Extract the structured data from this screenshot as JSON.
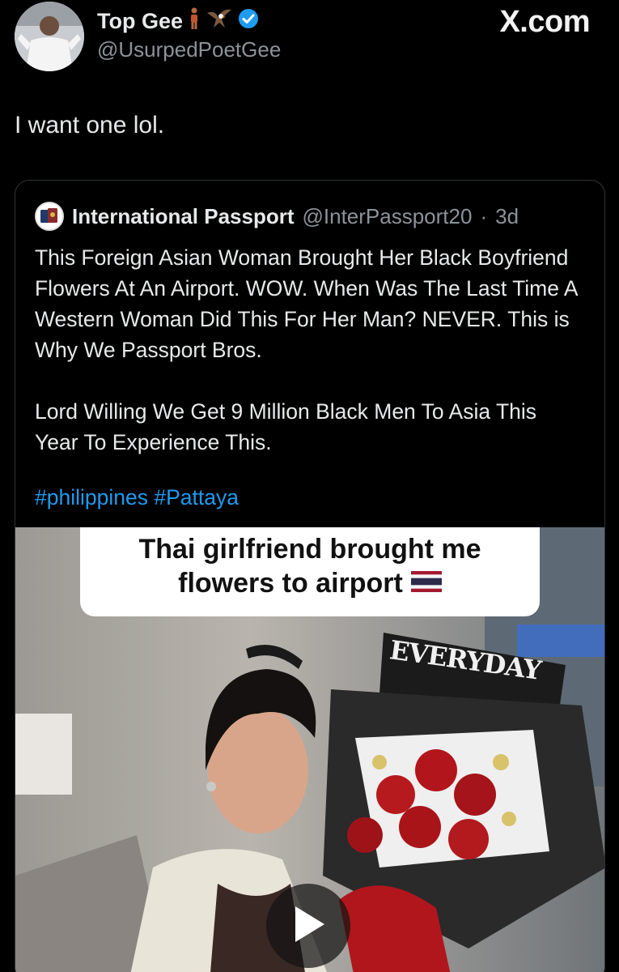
{
  "author": {
    "display_name": "Top Gee",
    "handle": "@UsurpedPoetGee",
    "verified_color": "#1d9bf0"
  },
  "brand": "X.com",
  "tweet": {
    "text": "I want one lol."
  },
  "quote": {
    "display_name": "International Passport",
    "handle": "@InterPassport20",
    "separator": "·",
    "time": "3d",
    "paragraphs": [
      "This Foreign Asian Woman Brought Her Black Boyfriend Flowers At An Airport. WOW. When Was The Last Time A Western Woman Did This For Her Man? NEVER. This is Why We Passport Bros.",
      "Lord Willing We Get 9 Million Black Men To Asia This Year To Experience This."
    ],
    "hashtags": [
      "#philippines",
      "#Pattaya"
    ]
  },
  "media": {
    "caption_line1": "Thai girlfriend brought me",
    "caption_line2": "flowers to airport",
    "sign_text": "EVERYDAY",
    "icons": [
      "thailand-flag-icon",
      "play-icon"
    ]
  },
  "colors": {
    "background": "#000000",
    "text": "#e7e9ea",
    "muted": "#8b9299",
    "link": "#1d9bf0",
    "border": "#2f3336"
  }
}
